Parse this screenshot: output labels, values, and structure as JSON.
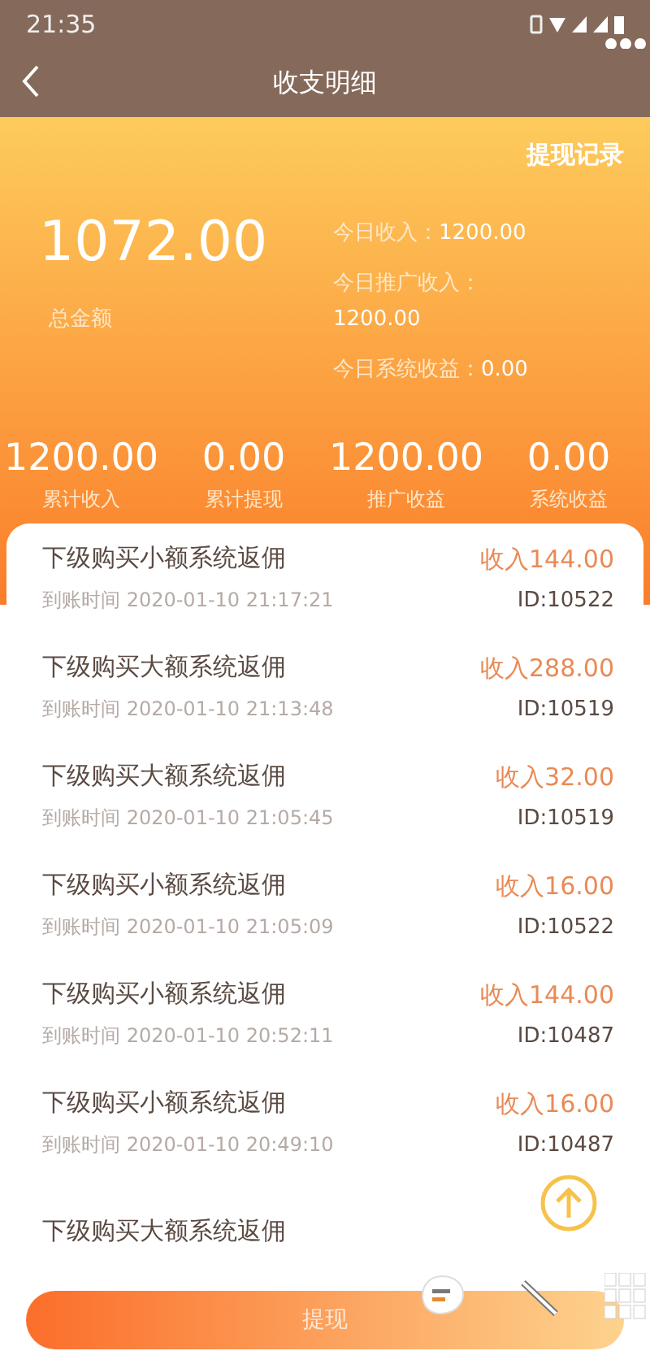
{
  "status_bar": {
    "time": "21:35"
  },
  "nav": {
    "title": "收支明细"
  },
  "header": {
    "link": "提现记录",
    "total": "1072.00",
    "total_label": "总金额",
    "today": [
      {
        "label": "今日收入：",
        "value": "1200.00"
      },
      {
        "label": "今日推广收入：",
        "value": "1200.00"
      },
      {
        "label": "今日系统收益：",
        "value": "0.00"
      }
    ],
    "stats": [
      {
        "value": "1200.00",
        "label": "累计收入"
      },
      {
        "value": "0.00",
        "label": "累计提现"
      },
      {
        "value": "1200.00",
        "label": "推广收益"
      },
      {
        "value": "0.00",
        "label": "系统收益"
      }
    ]
  },
  "records": [
    {
      "title": "下级购买小额系统返佣",
      "time": "到账时间 2020-01-10 21:17:21",
      "amount": "收入144.00",
      "id": "ID:10522"
    },
    {
      "title": "下级购买大额系统返佣",
      "time": "到账时间 2020-01-10 21:13:48",
      "amount": "收入288.00",
      "id": "ID:10519"
    },
    {
      "title": "下级购买大额系统返佣",
      "time": "到账时间 2020-01-10 21:05:45",
      "amount": "收入32.00",
      "id": "ID:10519"
    },
    {
      "title": "下级购买小额系统返佣",
      "time": "到账时间 2020-01-10 21:05:09",
      "amount": "收入16.00",
      "id": "ID:10522"
    },
    {
      "title": "下级购买小额系统返佣",
      "time": "到账时间 2020-01-10 20:52:11",
      "amount": "收入144.00",
      "id": "ID:10487"
    },
    {
      "title": "下级购买小额系统返佣",
      "time": "到账时间 2020-01-10 20:49:10",
      "amount": "收入16.00",
      "id": "ID:10487"
    },
    {
      "title": "下级购买大额系统返佣"
    }
  ],
  "withdraw_button": "提现"
}
